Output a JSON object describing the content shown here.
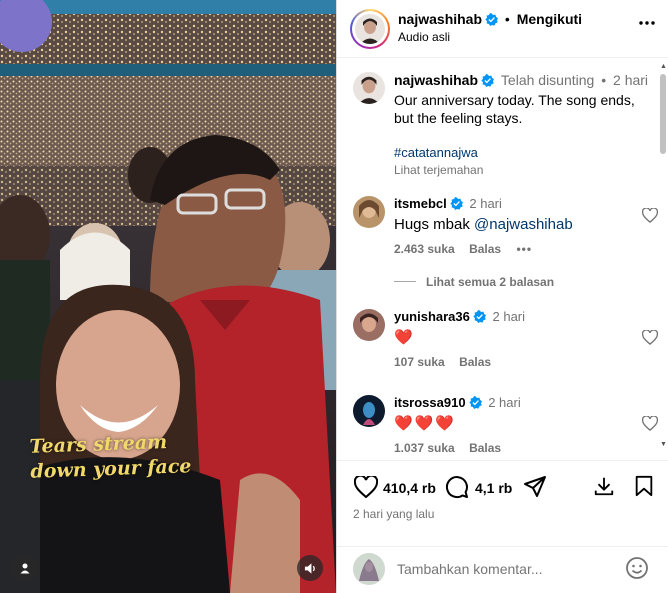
{
  "media": {
    "overlay_caption_line1": "Tears stream",
    "overlay_caption_line2": "down your face"
  },
  "header": {
    "username": "najwashihab",
    "separator": "•",
    "follow_status": "Mengikuti",
    "audio_label": "Audio asli",
    "more_icon": "more-horizontal-icon"
  },
  "post_caption": {
    "username": "najwashihab",
    "edited": "Telah disunting",
    "separator": "•",
    "time": "2 hari",
    "text": "Our anniversary today. The song ends, but the feeling stays.",
    "hashtag": "#catatannajwa",
    "translate": "Lihat terjemahan"
  },
  "comments": [
    {
      "username": "itsmebcl",
      "time": "2 hari",
      "text_prefix": "Hugs mbak ",
      "mention": "@najwashihab",
      "likes": "2.463 suka",
      "reply": "Balas",
      "view_replies": "Lihat semua 2 balasan"
    },
    {
      "username": "yunishara36",
      "time": "2 hari",
      "text": "❤️",
      "likes": "107 suka",
      "reply": "Balas"
    },
    {
      "username": "itsrossa910",
      "time": "2 hari",
      "text": "❤️❤️❤️",
      "likes": "1.037 suka",
      "reply": "Balas"
    }
  ],
  "footer": {
    "like_count": "410,4 rb",
    "comment_count": "4,1 rb",
    "posted_ago": "2 hari yang lalu",
    "add_comment_placeholder": "Tambahkan komentar..."
  },
  "colors": {
    "verified_blue": "#0095f6",
    "heart_red": "#ed4956",
    "link_blue": "#00376b",
    "muted_gray": "#737373",
    "caption_gold": "#f1d86a"
  }
}
